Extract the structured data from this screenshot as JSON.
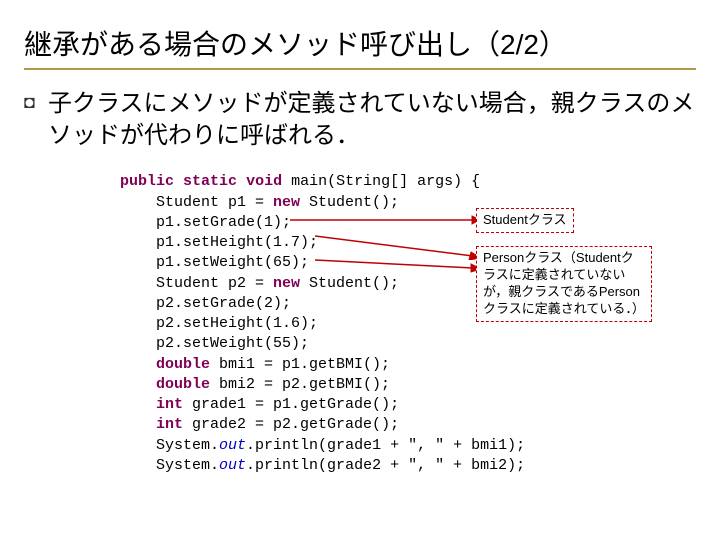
{
  "title": "継承がある場合のメソッド呼び出し（2/2）",
  "bullet_glyph": "◘",
  "body_text": "子クラスにメソッドが定義されていない場合，親クラスのメソッドが代わりに呼ばれる．",
  "callout1": "Studentクラス",
  "callout2": "Personクラス（Studentクラスに定義されていないが，親クラスであるPersonクラスに定義されている．）",
  "code": {
    "l01a": "public",
    "l01b": " ",
    "l01c": "static",
    "l01d": " ",
    "l01e": "void",
    "l01f": " main(String[] args) {",
    "l02": "    Student p1 = ",
    "l02b": "new",
    "l02c": " Student();",
    "l03": "    p1.setGrade(1);",
    "l04": "    p1.setHeight(1.7);",
    "l05": "    p1.setWeight(65);",
    "l06": "    Student p2 = ",
    "l06b": "new",
    "l06c": " Student();",
    "l07": "    p2.setGrade(2);",
    "l08": "    p2.setHeight(1.6);",
    "l09": "    p2.setWeight(55);",
    "l10a": "    ",
    "l10b": "double",
    "l10c": " bmi1 = p1.getBMI();",
    "l11a": "    ",
    "l11b": "double",
    "l11c": " bmi2 = p2.getBMI();",
    "l12a": "    ",
    "l12b": "int",
    "l12c": " grade1 = p1.getGrade();",
    "l13a": "    ",
    "l13b": "int",
    "l13c": " grade2 = p2.getGrade();",
    "l14a": "    System.",
    "l14b": "out",
    "l14c": ".println(grade1 + \", \" + bmi1);",
    "l15a": "    System.",
    "l15b": "out",
    "l15c": ".println(grade2 + \", \" + bmi2);"
  }
}
